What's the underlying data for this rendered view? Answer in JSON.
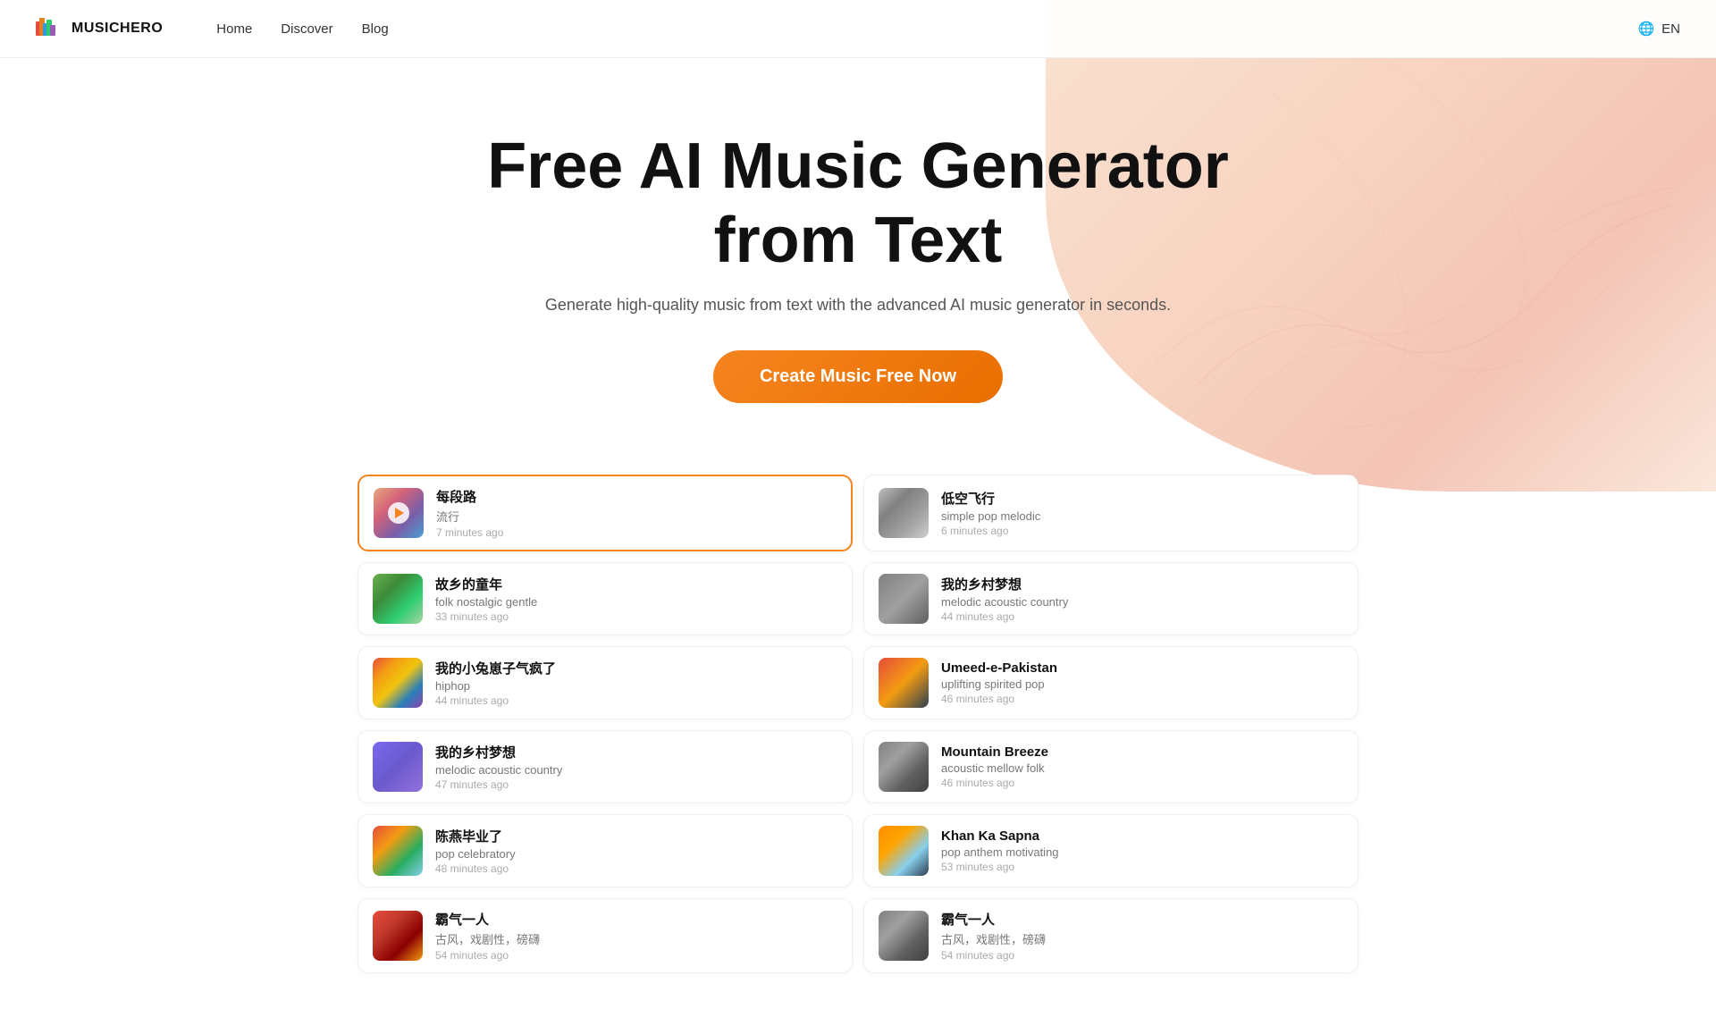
{
  "brand": {
    "name": "MUSICHERO",
    "logo_alt": "MusicHero Logo"
  },
  "nav": {
    "links": [
      {
        "id": "home",
        "label": "Home"
      },
      {
        "id": "discover",
        "label": "Discover"
      },
      {
        "id": "blog",
        "label": "Blog"
      }
    ],
    "lang_icon": "🌐",
    "lang_label": "EN"
  },
  "hero": {
    "title_line1": "Free AI Music Generator",
    "title_line2": "from Text",
    "subtitle": "Generate high-quality music from text with the advanced AI music generator in seconds.",
    "cta_label": "Create Music Free Now"
  },
  "music_list": [
    {
      "id": 1,
      "title": "每段路",
      "tags": "流行",
      "time": "7 minutes ago",
      "thumb_class": "thumb-1",
      "active": true
    },
    {
      "id": 2,
      "title": "低空飞行",
      "tags": "simple pop melodic",
      "time": "6 minutes ago",
      "thumb_class": "thumb-3",
      "active": false
    },
    {
      "id": 3,
      "title": "故乡的童年",
      "tags": "folk nostalgic gentle",
      "time": "33 minutes ago",
      "thumb_class": "thumb-2",
      "active": false
    },
    {
      "id": 4,
      "title": "我的乡村梦想",
      "tags": "melodic acoustic country",
      "time": "44 minutes ago",
      "thumb_class": "thumb-5",
      "active": false
    },
    {
      "id": 5,
      "title": "我的小兔崽子气疯了",
      "tags": "hiphop",
      "time": "44 minutes ago",
      "thumb_class": "thumb-4",
      "active": false
    },
    {
      "id": 6,
      "title": "Umeed-e-Pakistan",
      "tags": "uplifting spirited pop",
      "time": "46 minutes ago",
      "thumb_class": "thumb-6",
      "active": false
    },
    {
      "id": 7,
      "title": "我的乡村梦想",
      "tags": "melodic acoustic country",
      "time": "47 minutes ago",
      "thumb_class": "thumb-9",
      "active": false
    },
    {
      "id": 8,
      "title": "Mountain Breeze",
      "tags": "acoustic mellow folk",
      "time": "46 minutes ago",
      "thumb_class": "thumb-14",
      "active": false
    },
    {
      "id": 9,
      "title": "陈燕毕业了",
      "tags": "pop celebratory",
      "time": "48 minutes ago",
      "thumb_class": "thumb-11",
      "active": false
    },
    {
      "id": 10,
      "title": "Khan Ka Sapna",
      "tags": "pop anthem motivating",
      "time": "53 minutes ago",
      "thumb_class": "thumb-10",
      "active": false
    },
    {
      "id": 11,
      "title": "霸气一人",
      "tags": "古风，戏剧性，磅礴",
      "time": "54 minutes ago",
      "thumb_class": "thumb-13",
      "active": false
    },
    {
      "id": 12,
      "title": "霸气一人",
      "tags": "古风，戏剧性，磅礴",
      "time": "54 minutes ago",
      "thumb_class": "thumb-14",
      "active": false
    }
  ]
}
